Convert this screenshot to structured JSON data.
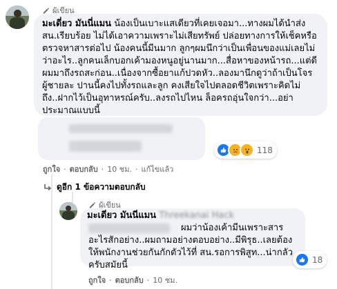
{
  "comment1": {
    "author_badge": "ผู้เขียน",
    "author_name": "มะเดี่ยว มันนี่แมน",
    "text": "น้องเป็นเบาะแสเดียวที่เคยเจอมา...ทางผมได้นำส่ง สน.เรียบร้อย ไม่ได้เอาความเพราะไม่เสียทรัพย์ ปล่อยทางการให้เช็คหรือตรวจหาสารต่อไป น้องคนนี้มีนมาก ลูกๆผมนึกว่าเป็นเพื่อนของแม่เลยไม่ว่าอะไร..ลูกคนเล็กบอกเค้ามองหนูอยู่นานมาก...สื่อหาของหน้ารถ...แต่ดีผมมาถึงรถสะก่อน..เนื่องจากซื้อยาแก้ปวดหัว..ลองมานึกดูว่าถ้าเป็นโจรผู้ชายละ ปานนี้คงไปทั้งรถและลูก คงเสียใจไปตลอดชีวิตเพราะคิดไม่ถึง..ฝากไว้เป็นอุทาหรณ์ครับ..ลงรถไปไหน ล็อครถอุ่นใจกว่า...อย่าประมาณแบบนี้",
    "actions": {
      "like": "ถูกใจ",
      "reply": "ตอบกลับ",
      "time": "10 ชม.",
      "edited": "แก้ไขแล้ว"
    }
  },
  "comment2": {
    "reactions_count": "118",
    "actions": {
      "like": "ถูกใจ",
      "reply": "ตอบกลับ",
      "time": "10 ชม."
    }
  },
  "replies_link": {
    "label": "ดูอีก 1 ข้อความตอบกลับ"
  },
  "comment3": {
    "author_badge": "ผู้เขียน",
    "author_name": "มะเดี่ยว มันนี่แมน",
    "mention_text": "Threekanai Hack",
    "text": "ผมว่าน้องเค้ามีนเพราะสารอะไรสักอย่าง..ผมถามอย่างตอบอย่าง..มีพิรุธ..เลยต้องให้พนักงานช่วยกันกักตัวไว้ที่ สน.รอการพิสูท...น่ากลัวครับสมัยนี้",
    "reactions_count": "18",
    "actions": {
      "like": "ถูกใจ",
      "reply": "ตอบกลับ",
      "time": "10 ชม."
    }
  },
  "colors": {
    "bubble": "#f0f2f5",
    "like_blue": "#1877f2",
    "haha_yellow": "#f7b125",
    "meta_gray": "#65676b"
  }
}
